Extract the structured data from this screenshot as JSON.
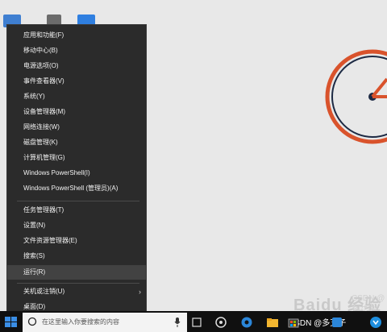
{
  "menu": {
    "items": [
      {
        "label": "应用和功能(F)"
      },
      {
        "label": "移动中心(B)"
      },
      {
        "label": "电源选项(O)"
      },
      {
        "label": "事件查看器(V)"
      },
      {
        "label": "系统(Y)"
      },
      {
        "label": "设备管理器(M)"
      },
      {
        "label": "网络连接(W)"
      },
      {
        "label": "磁盘管理(K)"
      },
      {
        "label": "计算机管理(G)"
      },
      {
        "label": "Windows PowerShell(I)"
      },
      {
        "label": "Windows PowerShell (管理员)(A)"
      },
      {
        "label": "任务管理器(T)"
      },
      {
        "label": "设置(N)"
      },
      {
        "label": "文件资源管理器(E)"
      },
      {
        "label": "搜索(S)"
      },
      {
        "label": "运行(R)"
      },
      {
        "label": "关机或注销(U)"
      },
      {
        "label": "桌面(D)"
      }
    ]
  },
  "taskbar": {
    "search_placeholder": "在这里输入你要搜索的内容"
  },
  "watermark": {
    "brand": "Baidu 经验",
    "credit": "CSDN @多艾子"
  },
  "colors": {
    "menu_bg": "#2b2b2b",
    "menu_selected": "#424242",
    "taskbar_bg": "#101010",
    "accent_orange": "#d9532c",
    "navy": "#1d2a44"
  }
}
